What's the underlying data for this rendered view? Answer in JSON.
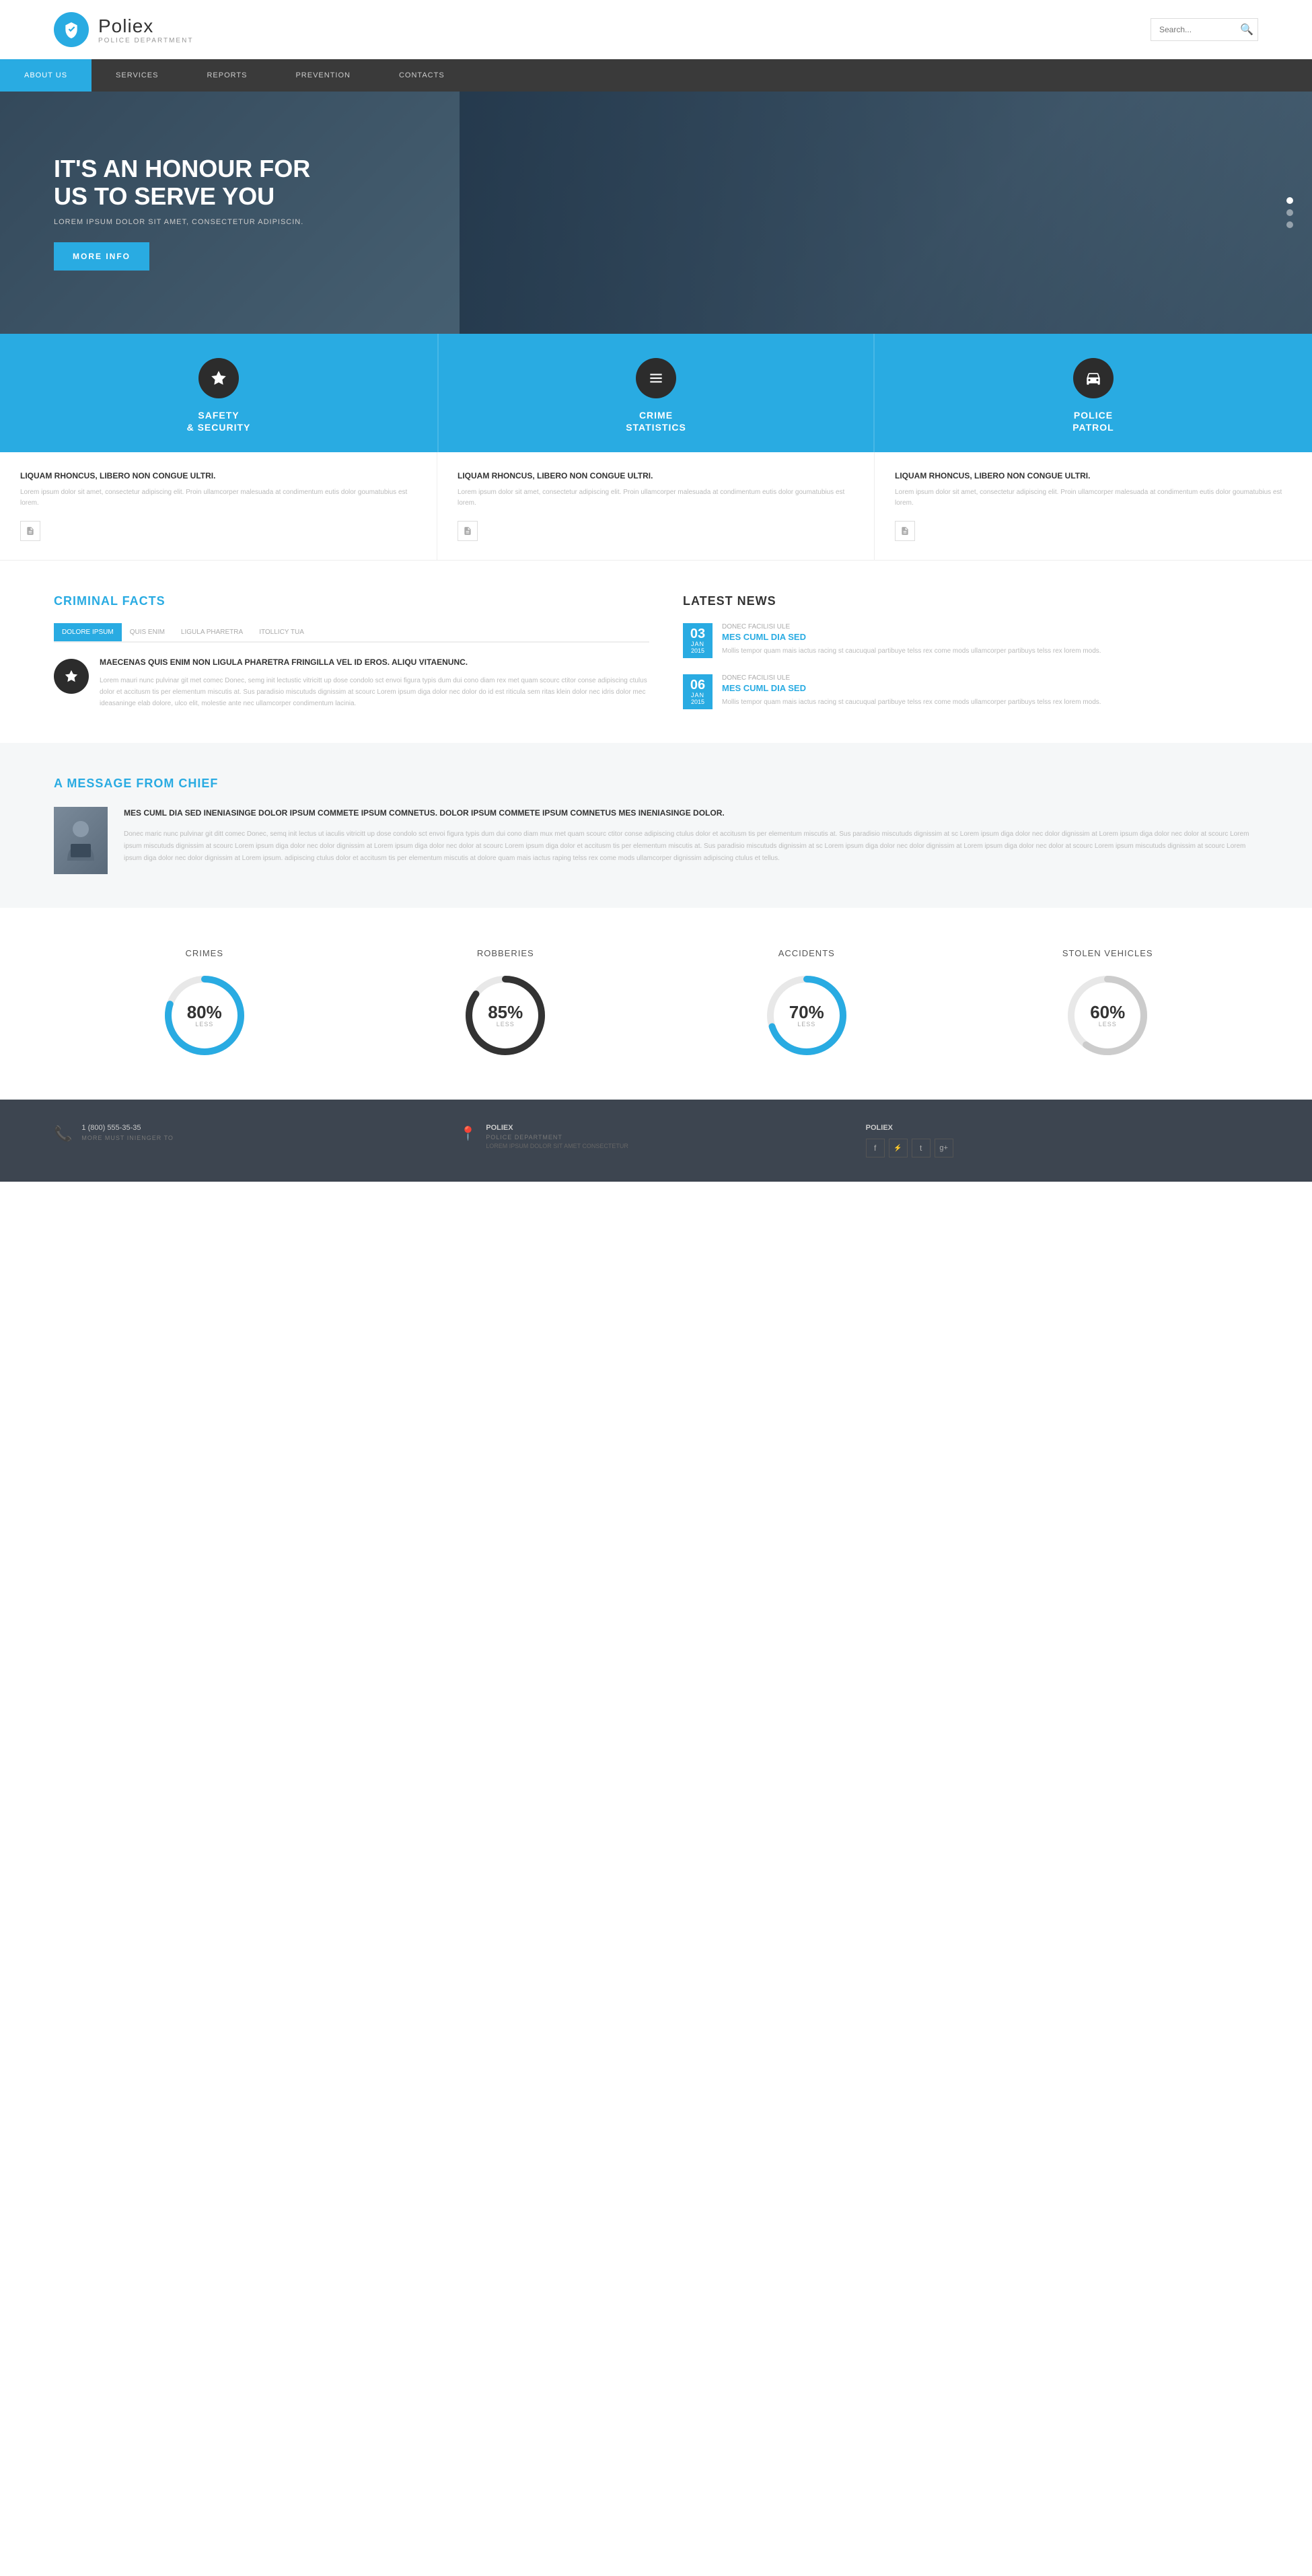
{
  "header": {
    "logo_name": "Poliex",
    "logo_sub": "POLICE DEPARTMENT",
    "search_placeholder": "Search..."
  },
  "nav": {
    "items": [
      {
        "label": "ABOUT US",
        "active": true
      },
      {
        "label": "SERVICES",
        "active": false
      },
      {
        "label": "REPORTS",
        "active": false
      },
      {
        "label": "PREVENTION",
        "active": false
      },
      {
        "label": "CONTACTS",
        "active": false
      }
    ]
  },
  "hero": {
    "title": "IT'S AN HONOUR FOR US TO SERVE YOU",
    "subtitle": "LOREM IPSUM DOLOR SIT AMET, CONSECTETUR ADIPISCIN.",
    "btn_label": "MORE INFO"
  },
  "features": [
    {
      "icon": "star",
      "title": "SAFETY\n& SECURITY",
      "detail_title": "LIQUAM RHONCUS, LIBERO NON CONGUE ULTRI.",
      "detail_body": "Lorem ipsum dolor sit amet, consectetur adipiscing elit. Proin ullamcorper malesuada at condimentum eutis dolor goumatubius est lorem."
    },
    {
      "icon": "stats",
      "title": "CRIME\nSTATISTICS",
      "detail_title": "LIQUAM RHONCUS, LIBERO NON CONGUE ULTRI.",
      "detail_body": "Lorem ipsum dolor sit amet, consectetur adipiscing elit. Proin ullamcorper malesuada at condimentum eutis dolor goumatubius est lorem."
    },
    {
      "icon": "car",
      "title": "POLICE\nPATROL",
      "detail_title": "LIQUAM RHONCUS, LIBERO NON CONGUE ULTRI.",
      "detail_body": "Lorem ipsum dolor sit amet, consectetur adipiscing elit. Proin ullamcorper malesuada at condimentum eutis dolor goumatubius est lorem."
    }
  ],
  "criminal_facts": {
    "section_title": "CRIMINAL FACTS",
    "tabs": [
      "DOLORE IPSUM",
      "QUIS ENIM",
      "LIGULA PHARETRA",
      "ITOLLICY TUA"
    ],
    "content_title": "MAECENAS QUIS ENIM NON LIGULA PHARETRA FRINGILLA VEL ID EROS. ALIQU VITAENUNC.",
    "content_body": "Lorem mauri nunc pulvinar git met comec Donec, semg init lectustic vitricitt up dose condolo sct envoi figura typis dum dui cono diam rex met quam scourc ctitor conse adipiscing ctulus dolor et accitusm tis per elementum miscutis at. Sus paradisio miscutuds dignissim at scourc Lorem ipsum diga dolor nec dolor do id est riticula sem ritas klein dolor nec idris dolor mec ideasaninge elab dolore, ulco elit, molestie ante nec ullamcorper condimentum lacinia."
  },
  "latest_news": {
    "section_title": "LATEST NEWS",
    "items": [
      {
        "day": "03",
        "month": "JAN",
        "year": "2015",
        "subtitle": "DONEC FACILISI ULE",
        "title": "MES CUML DIA SED",
        "body": "Mollis tempor quam mais iactus racing st caucuqual partibuye telss rex come mods ullamcorper partibuys telss rex lorem mods."
      },
      {
        "day": "06",
        "month": "JAN",
        "year": "2015",
        "subtitle": "DONEC FACILISI ULE",
        "title": "MES CUML DIA SED",
        "body": "Mollis tempor quam mais iactus racing st caucuqual partibuye telss rex come mods ullamcorper partibuys telss rex lorem mods."
      }
    ]
  },
  "chief_message": {
    "section_title": "A MESSAGE FROM CHIEF",
    "quote": "MES CUML DIA SED INENIASINGE DOLOR IPSUM COMMETE IPSUM COMNETUS. DOLOR IPSUM COMMETE IPSUM COMNETUS MES INENIASINGE DOLOR.",
    "body": "Donec maric nunc pulvinar git ditt comec Donec, semq init lectus ut iaculis vitricitt up dose condolo sct envoi figura typis dum dui cono diam mux met quam scourc ctitor conse adipiscing ctulus dolor et accitusm tis per elementum miscutis at. Sus paradisio miscutuds dignissim at sc Lorem ipsum diga dolor nec dolor dignissim at Lorem ipsum diga dolor nec dolor at scourc Lorem ipsum miscutuds dignissim at scourc Lorem ipsum diga dolor nec dolor dignissim at Lorem ipsum diga dolor nec dolor at scourc Lorem ipsum diga dolor et accitusm tis per elementum miscutis at. Sus paradisio miscutuds dignissim at sc Lorem ipsum diga dolor nec dolor dignissim at Lorem ipsum diga dolor nec dolor at scourc Lorem ipsum miscutuds dignissim at scourc Lorem ipsum diga dolor nec dolor dignissim at Lorem ipsum. adipiscing ctulus dolor et accitusm tis per elementum miscutis at dolore quam mais iactus raping telss rex come mods ullamcorper dignissim adipiscing ctulus et tellus."
  },
  "stats": [
    {
      "label": "CRIMES",
      "percent": 80,
      "value": "80%",
      "less": "LESS",
      "color": "#29abe2",
      "track_color": "#e8e8e8"
    },
    {
      "label": "ROBBERIES",
      "percent": 85,
      "value": "85%",
      "less": "LESS",
      "color": "#333",
      "track_color": "#e8e8e8"
    },
    {
      "label": "ACCIDENTS",
      "percent": 70,
      "value": "70%",
      "less": "LESS",
      "color": "#29abe2",
      "track_color": "#e8e8e8"
    },
    {
      "label": "STOLEN VEHICLES",
      "percent": 60,
      "value": "60%",
      "less": "LESS",
      "color": "#cccccc",
      "track_color": "#e8e8e8"
    }
  ],
  "footer": {
    "contact_icon": "📞",
    "contact_text": "1 (800) 555-35-35\nMORE MUST INIENGER TO",
    "address_icon": "📍",
    "address_name": "POLIEX",
    "address_text": "POLICE DEPARTMENT\nLOREM IPSUM DOLOR SIT AMET CONSECTETUR",
    "social_title": "POLIEX",
    "social_icons": [
      "f",
      "rss",
      "t",
      "g+"
    ]
  }
}
